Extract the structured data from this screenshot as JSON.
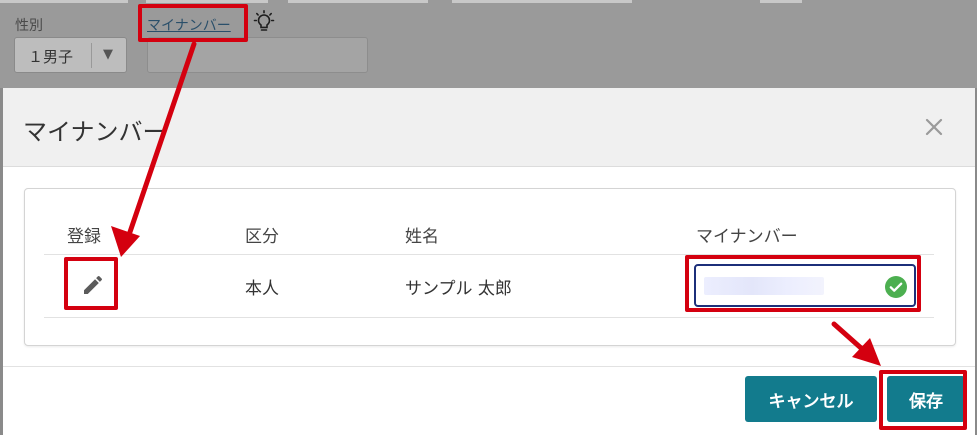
{
  "background_form": {
    "gender_label": "性別",
    "gender_value": "１男子",
    "gender_arrow": "▼",
    "mynumber_link": "マイナンバー",
    "hint_icon": "lightbulb-icon"
  },
  "modal": {
    "title": "マイナンバー",
    "close_icon": "close-icon",
    "table": {
      "headers": [
        "登録",
        "区分",
        "姓名",
        "マイナンバー"
      ],
      "rows": [
        {
          "edit_icon": "pencil-icon",
          "category": "本人",
          "name": "サンプル 太郎",
          "verified_icon": "check-circle-icon"
        }
      ]
    },
    "buttons": {
      "cancel": "キャンセル",
      "save": "保存"
    }
  },
  "colors": {
    "accent": "#127b8d",
    "annotation": "#d4000f",
    "verified": "#4caf50",
    "field_border": "#1c2f7a"
  }
}
